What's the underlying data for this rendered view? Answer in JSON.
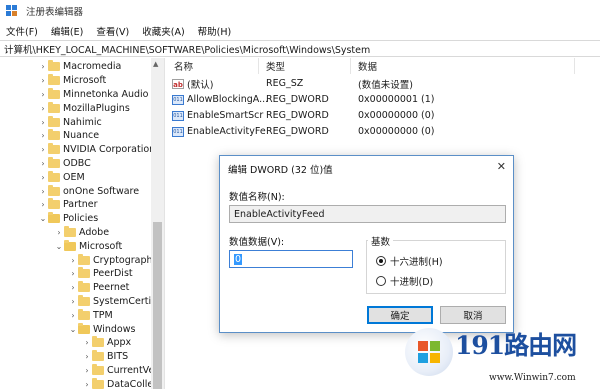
{
  "window": {
    "title": "注册表编辑器"
  },
  "menu": [
    "文件(F)",
    "编辑(E)",
    "查看(V)",
    "收藏夹(A)",
    "帮助(H)"
  ],
  "address": "计算机\\HKEY_LOCAL_MACHINE\\SOFTWARE\\Policies\\Microsoft\\Windows\\System",
  "tree": [
    {
      "label": "Macromedia",
      "indent": 1,
      "expanded": false
    },
    {
      "label": "Microsoft",
      "indent": 1,
      "expanded": false
    },
    {
      "label": "Minnetonka Audio S",
      "indent": 1,
      "expanded": false
    },
    {
      "label": "MozillaPlugins",
      "indent": 1,
      "expanded": false
    },
    {
      "label": "Nahimic",
      "indent": 1,
      "expanded": false
    },
    {
      "label": "Nuance",
      "indent": 1,
      "expanded": false
    },
    {
      "label": "NVIDIA Corporation",
      "indent": 1,
      "expanded": false
    },
    {
      "label": "ODBC",
      "indent": 1,
      "expanded": false
    },
    {
      "label": "OEM",
      "indent": 1,
      "expanded": false
    },
    {
      "label": "onOne Software",
      "indent": 1,
      "expanded": false
    },
    {
      "label": "Partner",
      "indent": 1,
      "expanded": false
    },
    {
      "label": "Policies",
      "indent": 1,
      "expanded": true
    },
    {
      "label": "Adobe",
      "indent": 2,
      "expanded": false
    },
    {
      "label": "Microsoft",
      "indent": 2,
      "expanded": true
    },
    {
      "label": "Cryptography",
      "indent": 3,
      "expanded": false
    },
    {
      "label": "PeerDist",
      "indent": 3,
      "expanded": false
    },
    {
      "label": "Peernet",
      "indent": 3,
      "expanded": false
    },
    {
      "label": "SystemCertific",
      "indent": 3,
      "expanded": false
    },
    {
      "label": "TPM",
      "indent": 3,
      "expanded": false
    },
    {
      "label": "Windows",
      "indent": 3,
      "expanded": true
    },
    {
      "label": "Appx",
      "indent": 4,
      "expanded": false
    },
    {
      "label": "BITS",
      "indent": 4,
      "expanded": false
    },
    {
      "label": "CurrentVers",
      "indent": 4,
      "expanded": false
    },
    {
      "label": "DataCollect",
      "indent": 4,
      "expanded": false
    }
  ],
  "values_header": {
    "name": "名称",
    "type": "类型",
    "data": "数据"
  },
  "values": [
    {
      "name": "(默认)",
      "type": "REG_SZ",
      "data": "(数值未设置)",
      "icon": "string-value-icon"
    },
    {
      "name": "AllowBlockingA...",
      "type": "REG_DWORD",
      "data": "0x00000001 (1)",
      "icon": "binary-value-icon"
    },
    {
      "name": "EnableSmartScr",
      "type": "REG_DWORD",
      "data": "0x00000000 (0)",
      "icon": "binary-value-icon"
    },
    {
      "name": "EnableActivityFe",
      "type": "REG_DWORD",
      "data": "0x00000000 (0)",
      "icon": "binary-value-icon"
    }
  ],
  "dialog": {
    "title": "编辑 DWORD (32 位)值",
    "close": "✕",
    "name_label": "数值名称(N):",
    "name_value": "EnableActivityFeed",
    "data_label": "数值数据(V):",
    "data_value": "0",
    "base_label": "基数",
    "radio_hex": "十六进制(H)",
    "radio_dec": "十进制(D)",
    "selected_base": "hex",
    "ok": "确定",
    "cancel": "取消"
  },
  "watermark": {
    "brand": "191路由网",
    "url": "www.Winwin7.com"
  }
}
